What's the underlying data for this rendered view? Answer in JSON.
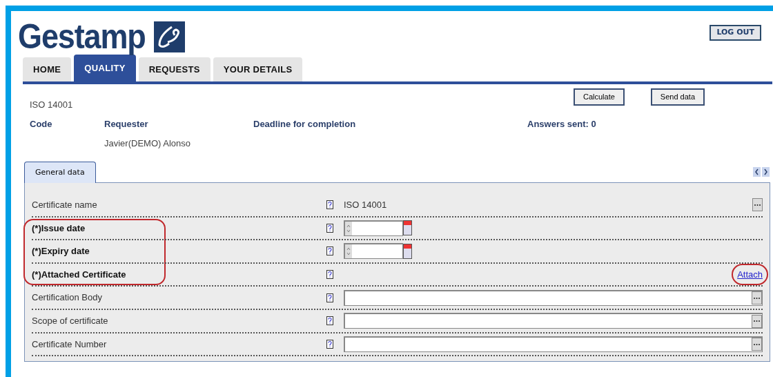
{
  "logo": {
    "text": "Gestamp"
  },
  "logout": "LOG OUT",
  "tabs": [
    {
      "label": "HOME",
      "selected": false
    },
    {
      "label": "QUALITY",
      "selected": true
    },
    {
      "label": "REQUESTS",
      "selected": false
    },
    {
      "label": "YOUR DETAILS",
      "selected": false
    }
  ],
  "header": {
    "title": "ISO 14001",
    "buttons": [
      "Calculate",
      "Send data"
    ],
    "code_label": "Code",
    "requester_label": "Requester",
    "requester": "Javier(DEMO) Alonso",
    "deadline_label": "Deadline for completion",
    "answers": "Answers sent: 0"
  },
  "subtabs": [
    {
      "label": "General data",
      "selected": true
    }
  ],
  "rows": [
    {
      "kind": "text",
      "label": "Certificate name",
      "required": false,
      "highlighted": false,
      "value": "ISO 14001"
    },
    {
      "kind": "date",
      "label": "(*)Issue date",
      "required": true,
      "highlighted": true
    },
    {
      "kind": "date",
      "label": "(*)Expiry date",
      "required": true,
      "highlighted": true
    },
    {
      "kind": "attach",
      "label": "(*)Attached Certificate",
      "required": true,
      "highlighted": true,
      "link": "Attach",
      "link_highlighted": true
    },
    {
      "kind": "input",
      "label": "Certification Body",
      "required": false,
      "highlighted": false
    },
    {
      "kind": "input",
      "label": "Scope of certificate",
      "required": false,
      "highlighted": false
    },
    {
      "kind": "input",
      "label": "Certificate Number",
      "required": false,
      "highlighted": false
    }
  ]
}
